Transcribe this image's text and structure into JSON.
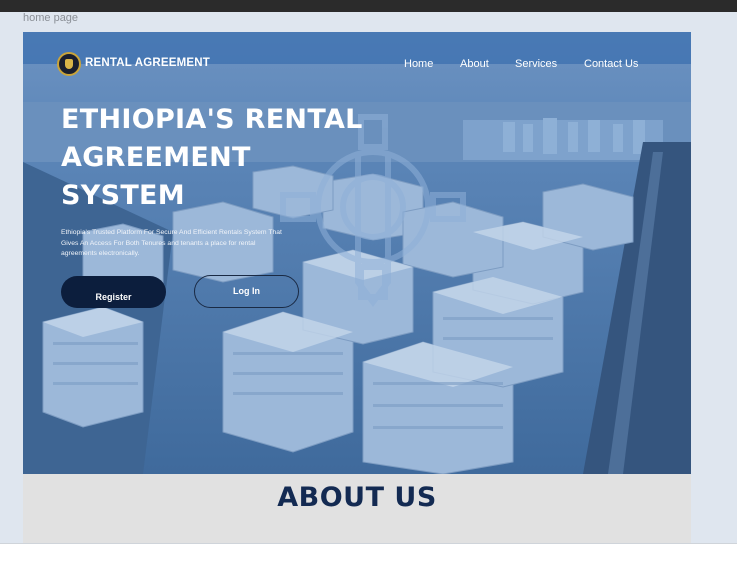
{
  "page_label": "home page",
  "brand": {
    "name": "RENTAL AGREEMENT",
    "logo_icon": "emblem-logo-icon"
  },
  "nav": {
    "items": [
      {
        "label": "Home"
      },
      {
        "label": "About"
      },
      {
        "label": "Services"
      },
      {
        "label": "Contact Us"
      }
    ]
  },
  "hero": {
    "headline": "ETHIOPIA'S RENTAL AGREEMENT SYSTEM",
    "description": "Ethiopia's Trusted Platform For Secure And Efficient Rentals System That Gives An Access For Both Tenures and tenants a place for rental agreements electronically.",
    "register_label": "Register",
    "login_label": "Log In",
    "background_icon": "gear-pen-watermark-icon"
  },
  "about": {
    "title": "ABOUT US"
  },
  "colors": {
    "nav_overlay": "#2c65aa",
    "hero_tint": "#4f79a8",
    "register_bg": "#0c1e3d",
    "about_title": "#132a52",
    "about_bg": "#e1e1e1",
    "canvas_bg": "#dfe6ef"
  }
}
